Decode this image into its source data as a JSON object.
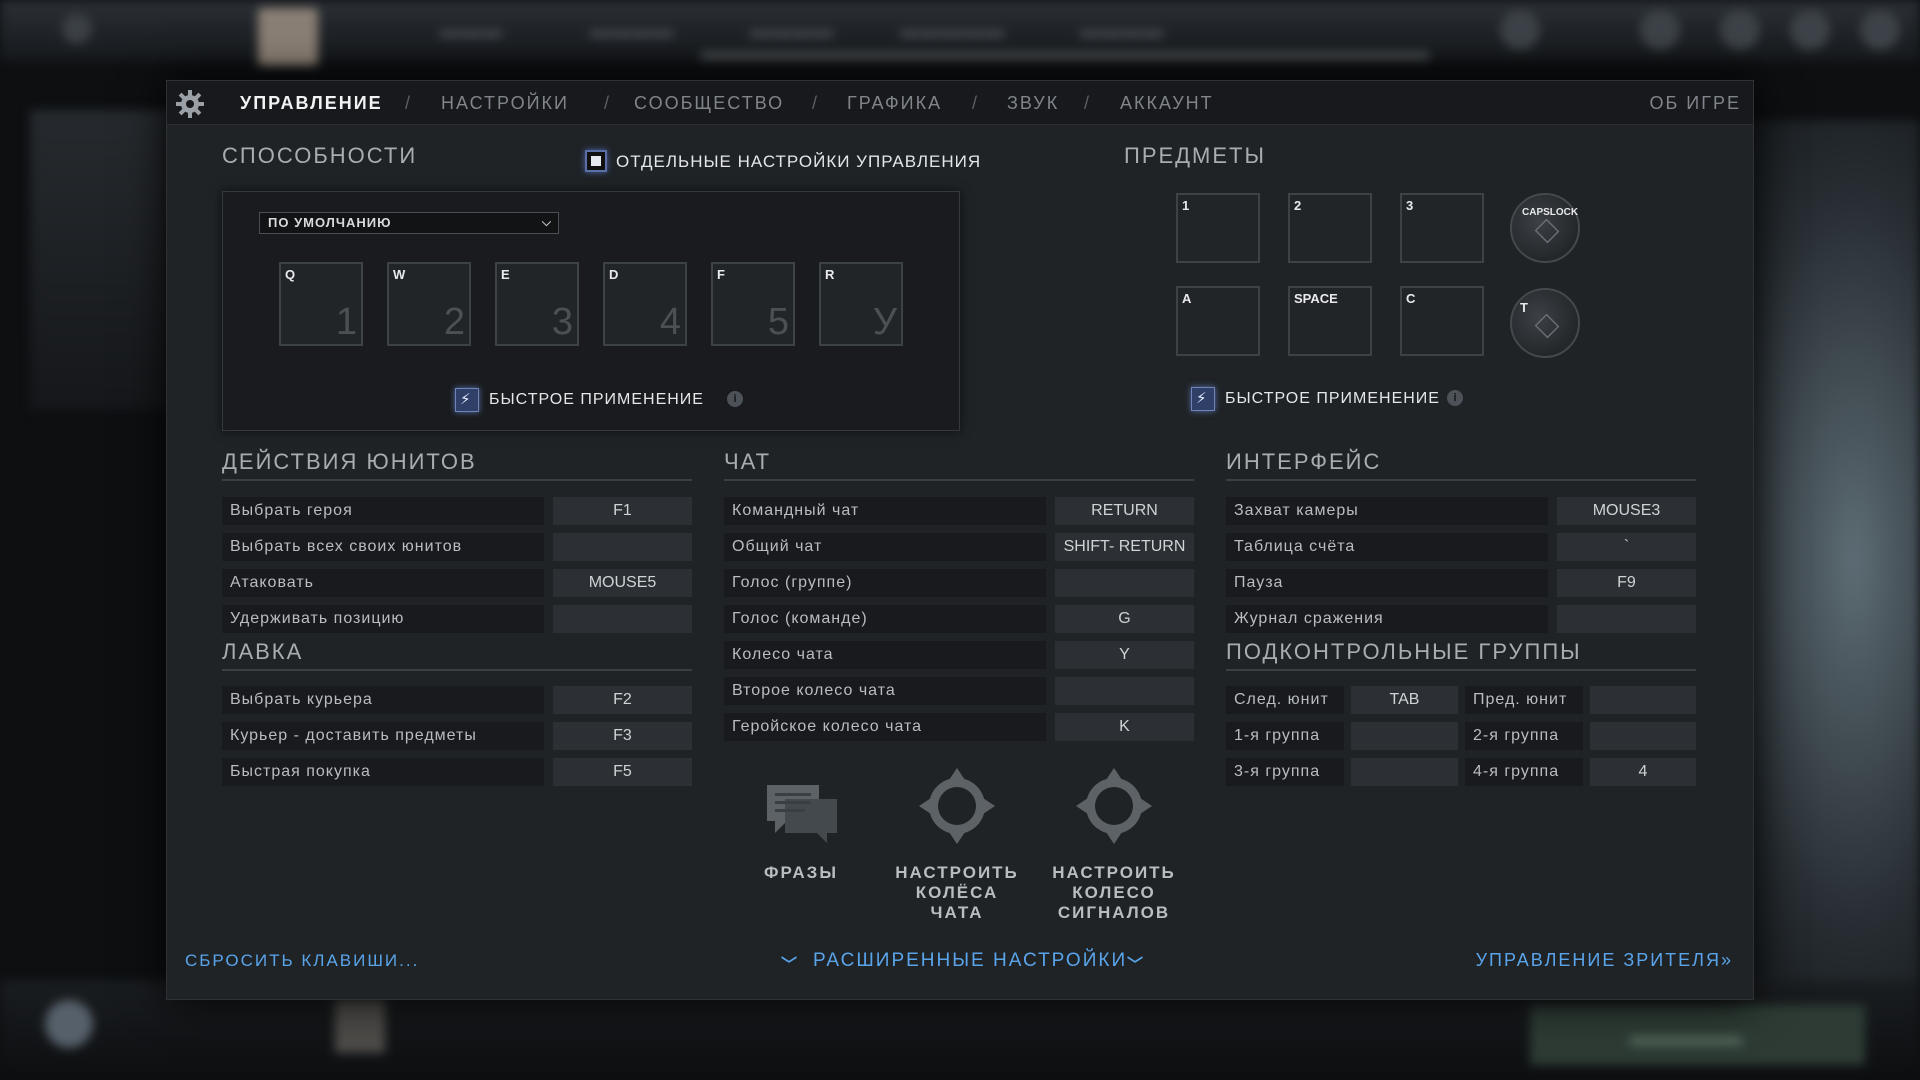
{
  "tabs": {
    "controls": "УПРАВЛЕНИЕ",
    "settings": "НАСТРОЙКИ",
    "community": "СООБЩЕСТВО",
    "graphics": "ГРАФИКА",
    "sound": "ЗВУК",
    "account": "АККАУНТ",
    "about": "ОБ ИГРЕ",
    "separator": "/"
  },
  "abilities": {
    "title": "СПОСОБНОСТИ",
    "separate_controls_label": "ОТДЕЛЬНЫЕ НАСТРОЙКИ УПРАВЛЕНИЯ",
    "preset": "ПО УМОЛЧАНИЮ",
    "keys": [
      {
        "key": "Q",
        "slot": "1"
      },
      {
        "key": "W",
        "slot": "2"
      },
      {
        "key": "E",
        "slot": "3"
      },
      {
        "key": "D",
        "slot": "4"
      },
      {
        "key": "F",
        "slot": "5"
      },
      {
        "key": "R",
        "slot": "У"
      }
    ],
    "quickcast": "БЫСТРОЕ ПРИМЕНЕНИЕ"
  },
  "items": {
    "title": "ПРЕДМЕТЫ",
    "keys": [
      "1",
      "2",
      "3",
      "A",
      "SPACE",
      "C"
    ],
    "neutral_key": "CAPSLOCK",
    "tp_key": "T",
    "quickcast": "БЫСТРОЕ ПРИМЕНЕНИЕ"
  },
  "unit_actions": {
    "title": "ДЕЙСТВИЯ ЮНИТОВ",
    "rows": [
      {
        "label": "Выбрать героя",
        "key": "F1"
      },
      {
        "label": "Выбрать всех своих юнитов",
        "key": ""
      },
      {
        "label": "Атаковать",
        "key": "MOUSE5"
      },
      {
        "label": "Удерживать позицию",
        "key": ""
      }
    ]
  },
  "shop": {
    "title": "ЛАВКА",
    "rows": [
      {
        "label": "Выбрать курьера",
        "key": "F2"
      },
      {
        "label": "Курьер - доставить предметы",
        "key": "F3"
      },
      {
        "label": "Быстрая покупка",
        "key": "F5"
      }
    ]
  },
  "chat": {
    "title": "ЧАТ",
    "rows": [
      {
        "label": "Командный чат",
        "key": "RETURN"
      },
      {
        "label": "Общий чат",
        "key": "SHIFT- RETURN"
      },
      {
        "label": "Голос (группе)",
        "key": ""
      },
      {
        "label": "Голос (команде)",
        "key": "G"
      },
      {
        "label": "Колесо чата",
        "key": "Y"
      },
      {
        "label": "Второе колесо чата",
        "key": ""
      },
      {
        "label": "Геройское колесо чата",
        "key": "K"
      }
    ],
    "buttons": {
      "phrases": "ФРАЗЫ",
      "chat_wheels": "НАСТРОИТЬ КОЛЁСА ЧАТА",
      "signal_wheel": "НАСТРОИТЬ КОЛЕСО СИГНАЛОВ"
    }
  },
  "interface": {
    "title": "ИНТЕРФЕЙС",
    "rows": [
      {
        "label": "Захват камеры",
        "key": "MOUSE3"
      },
      {
        "label": "Таблица счёта",
        "key": "`"
      },
      {
        "label": "Пауза",
        "key": "F9"
      },
      {
        "label": "Журнал сражения",
        "key": ""
      }
    ]
  },
  "control_groups": {
    "title": "ПОДКОНТРОЛЬНЫЕ ГРУППЫ",
    "rows": [
      {
        "label": "След. юнит",
        "key": "TAB",
        "label2": "Пред. юнит",
        "key2": ""
      },
      {
        "label": "1-я группа",
        "key": "",
        "label2": "2-я группа",
        "key2": ""
      },
      {
        "label": "3-я группа",
        "key": "",
        "label2": "4-я группа",
        "key2": "4"
      }
    ]
  },
  "footer": {
    "reset": "СБРОСИТЬ КЛАВИШИ...",
    "advanced": "РАСШИРЕННЫЕ НАСТРОЙКИ",
    "spectator": "УПРАВЛЕНИЕ ЗРИТЕЛЯ",
    "spectator_glyph": "»"
  },
  "colors": {
    "link": "#5aa4ea",
    "accent": "#5a6fa8",
    "panel": "#1f2326"
  }
}
